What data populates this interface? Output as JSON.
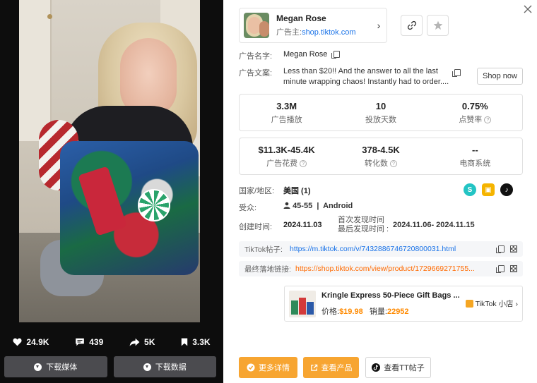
{
  "video_stats": {
    "likes": "24.9K",
    "comments": "439",
    "shares": "5K",
    "saves": "3.3K"
  },
  "downloads": {
    "media_label": "下载媒体",
    "data_label": "下载数据"
  },
  "advertiser": {
    "name": "Megan Rose",
    "owner_prefix": "广告主:",
    "owner_link": "shop.tiktok.com"
  },
  "fields": {
    "ad_name_label": "广告名字:",
    "ad_name_value": "Megan Rose",
    "ad_copy_label": "广告文案:",
    "ad_copy_line1": "Less than $20!! And the answer to all the last",
    "ad_copy_line2": "minute wrapping chaos! Instantly had to order....",
    "cta": "Shop now",
    "region_label": "国家/地区:",
    "region_value": "美国 (1)",
    "audience_label": "受众:",
    "audience_age": "45-55",
    "audience_os": "Android",
    "created_label": "创建时间:",
    "created_value": "2024.11.03",
    "first_seen_label": "首次发现时间",
    "last_seen_label": "最后发现时间 :",
    "seen_range": "2024.11.06- 2024.11.15"
  },
  "metrics_top": [
    {
      "value": "3.3M",
      "label": "广告播放",
      "help": false
    },
    {
      "value": "10",
      "label": "投放天数",
      "help": false
    },
    {
      "value": "0.75%",
      "label": "点赞率",
      "help": true
    }
  ],
  "metrics_bottom": [
    {
      "value": "$11.3K-45.4K",
      "label": "广告花费",
      "help": true
    },
    {
      "value": "378-4.5K",
      "label": "转化数",
      "help": true
    },
    {
      "value": "--",
      "label": "电商系统",
      "help": false
    }
  ],
  "links": {
    "tiktok_label": "TikTok帖子:",
    "tiktok_url": "https://m.tiktok.com/v/7432886746720800031.html",
    "landing_label": "最终落地链接:",
    "landing_url": "https://shop.tiktok.com/view/product/1729669271755..."
  },
  "product": {
    "title": "Kringle Express 50-Piece Gift Bags ...",
    "price_label": "价格:",
    "price": "$19.98",
    "sales_label": "销量:",
    "sales": "22952",
    "shop_label": "TikTok 小店"
  },
  "actions": {
    "more_details": "更多详情",
    "view_product": "查看产品",
    "view_post": "查看TT帖子"
  },
  "colors": {
    "accent_orange": "#f7a531",
    "link_blue": "#1a73e8",
    "landing_orange": "#ff6a00"
  }
}
